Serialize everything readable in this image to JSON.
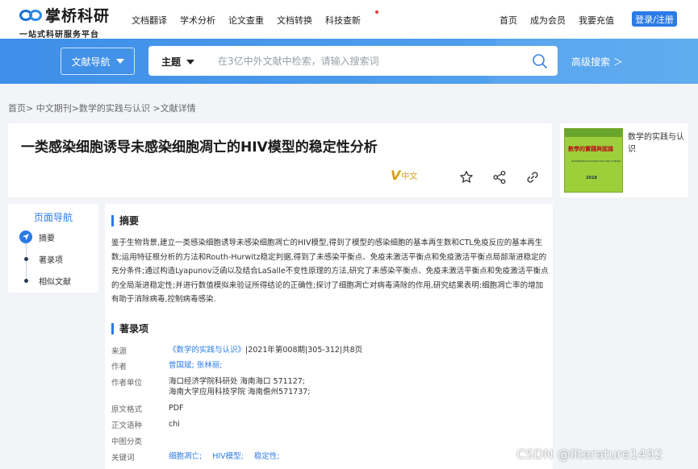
{
  "brand": {
    "name": "掌桥科研",
    "slogan": "一站式科研服务平台"
  },
  "topnav": {
    "items": [
      "文档翻译",
      "学术分析",
      "论文查重",
      "文档转换",
      "科技查新"
    ]
  },
  "topright": {
    "home": "首页",
    "member": "成为会员",
    "recharge": "我要充值",
    "login": "登录/注册"
  },
  "search": {
    "docnav": "文献导航",
    "scope": "主题",
    "placeholder": "在3亿中外文献中检索，请输入搜索词",
    "advanced": "高级搜索 ＞"
  },
  "breadcrumb": "首页> 中文期刊>数学的实践与认识 >文献详情",
  "article": {
    "title": "一类感染细胞诱导未感染细胞凋亡的HIV模型的稳定性分析",
    "lang": "中文"
  },
  "journal": {
    "name": "数学的实践与认识",
    "cover_title": "數學的實踐與認識",
    "cover_sub": "MATHEMATICS IN PRACTICE AND THEORY",
    "cover_year": "2018"
  },
  "pagenav": {
    "title": "页面导航",
    "items": [
      "摘要",
      "著录项",
      "相似文献"
    ]
  },
  "abstract": {
    "heading": "摘要",
    "text": "鉴于生物背景,建立一类感染细胞诱导未感染细胞凋亡的HIV模型,得到了模型的感染细胞的基本再生数和CTL免疫反应的基本再生数;运用特征根分析的方法和Routh-Hurwitz稳定判据,得到了未感染平衡点、免疫未激活平衡点和免疫激活平衡点局部渐进稳定的充分条件;通过构造Lyapunov泛函以及结合LaSalle不变性原理的方法,研究了未感染平衡点、免疫未激活平衡点和免疫激活平衡点的全局渐进稳定性;并进行数值模拟来验证所得结论的正确性;探讨了细胞凋亡对病毒清除的作用,研究结果表明:细胞凋亡率的增加有助于消除病毒,控制病毒感染."
  },
  "record": {
    "heading": "著录项",
    "source_label": "来源",
    "source_link": "《数学的实践与认识》",
    "source_rest": "|2021年第008期|305-312|共8页",
    "author_label": "作者",
    "authors": "曾国斌; 张林丽;",
    "unit_label": "作者单位",
    "unit1": "海口经济学院科研处 海南海口 571127;",
    "unit2": "海南大学应用科技学院 海南儋州571737;",
    "format_label": "原文格式",
    "format": "PDF",
    "lang_label": "正文语种",
    "lang": "chi",
    "clc_label": "中图分类",
    "kw_label": "关键词",
    "keywords": [
      "细胞凋亡;",
      "HIV模型;",
      "稳定性;"
    ]
  },
  "watermark": "CSDN @literature1492",
  "colors": {
    "accent": "#2b7be6",
    "banner": "#4a9aec",
    "badge": "#d4a017"
  }
}
